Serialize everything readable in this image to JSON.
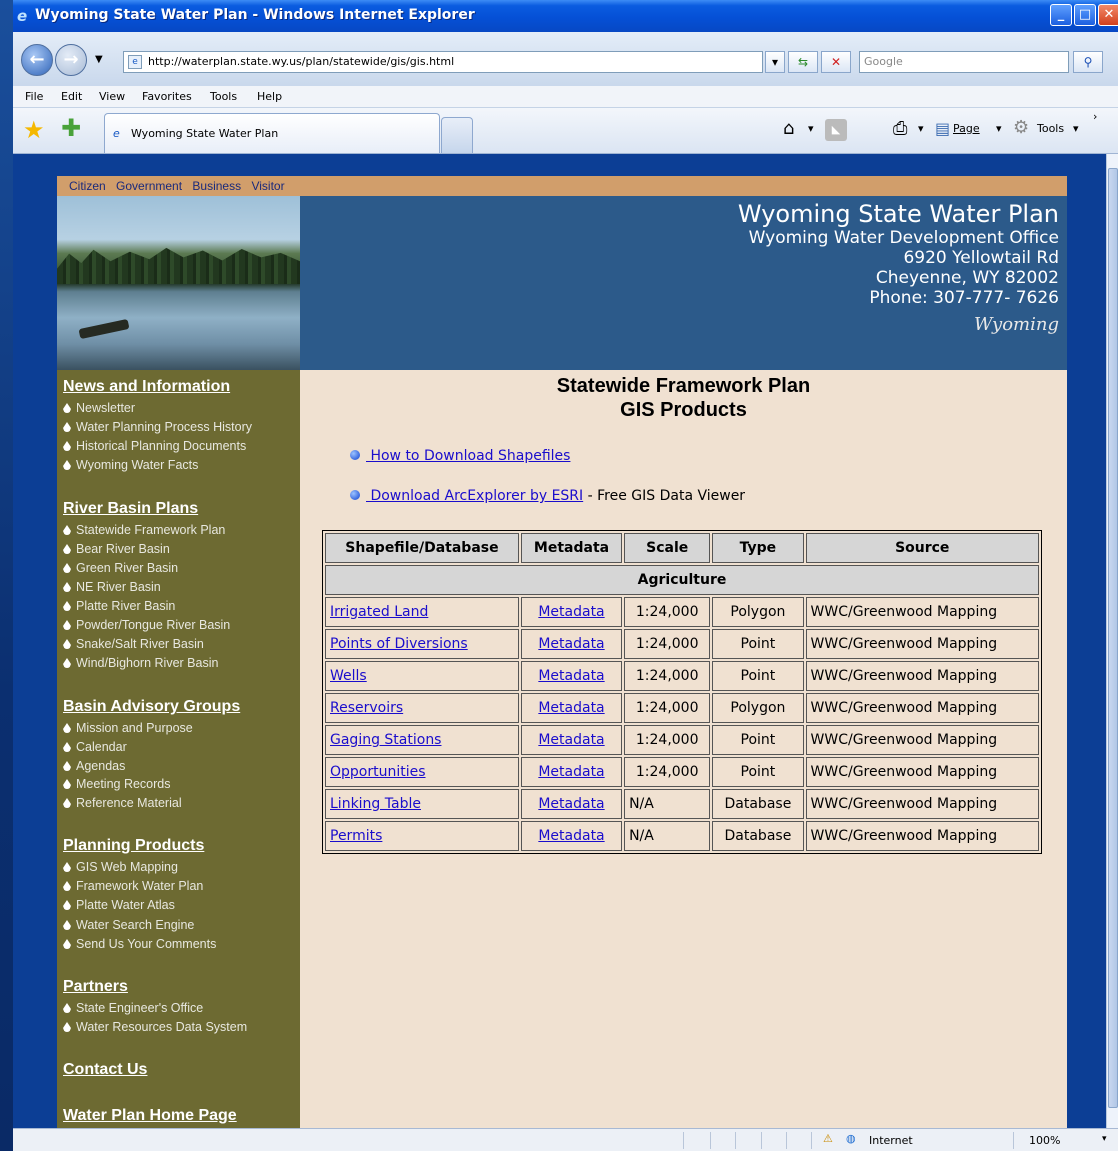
{
  "window": {
    "title": "Wyoming State Water Plan - Windows Internet Explorer"
  },
  "address": {
    "url": "http://waterplan.state.wy.us/plan/statewide/gis/gis.html"
  },
  "search": {
    "placeholder": "Google"
  },
  "menu": [
    "File",
    "Edit",
    "View",
    "Favorites",
    "Tools",
    "Help"
  ],
  "tab": {
    "label": "Wyoming State Water Plan"
  },
  "commands": {
    "page": "Page",
    "tools": "Tools"
  },
  "status": {
    "zone": "Internet",
    "zoom": "100%"
  },
  "topnav": [
    "Citizen",
    "Government",
    "Business",
    "Visitor"
  ],
  "header": {
    "title": "Wyoming State Water Plan",
    "office": "Wyoming Water Development Office",
    "street": "6920 Yellowtail Rd",
    "city": "Cheyenne, WY 82002",
    "phone": "Phone: 307-777- 7626",
    "logo": "Wyoming"
  },
  "sidebar": {
    "news": {
      "title": "News and Information",
      "items": [
        "Newsletter",
        "Water Planning Process History",
        "Historical Planning Documents",
        "Wyoming Water Facts"
      ]
    },
    "basins": {
      "title": "River Basin Plans",
      "items": [
        "Statewide Framework Plan",
        "Bear River Basin",
        "Green River Basin",
        "NE River Basin",
        "Platte River Basin",
        "Powder/Tongue River Basin",
        "Snake/Salt River Basin",
        "Wind/Bighorn River Basin"
      ]
    },
    "advisory": {
      "title": "Basin Advisory Groups",
      "items": [
        "Mission and Purpose",
        "Calendar",
        "Agendas",
        "Meeting Records",
        "Reference Material"
      ]
    },
    "products": {
      "title": "Planning Products",
      "items": [
        "GIS Web Mapping",
        "Framework Water Plan",
        "Platte Water Atlas",
        "Water Search Engine",
        "Send Us Your Comments"
      ]
    },
    "partners": {
      "title": "Partners",
      "items": [
        "State Engineer's Office",
        "Water Resources Data System"
      ]
    },
    "contact": "Contact Us",
    "home": "Water Plan Home Page"
  },
  "main": {
    "title1": "Statewide Framework Plan",
    "title2": "GIS Products",
    "link1": " How to Download Shapefiles",
    "link2": " Download ArcExplorer by ESRI",
    "link2_suffix": " - Free GIS Data Viewer",
    "table": {
      "headers": [
        "Shapefile/Database",
        "Metadata",
        "Scale",
        "Type",
        "Source"
      ],
      "section": "Agriculture",
      "rows": [
        [
          "Irrigated Land",
          "Metadata",
          "1:24,000",
          "Polygon",
          "WWC/Greenwood Mapping"
        ],
        [
          "Points of Diversions",
          "Metadata",
          "1:24,000",
          "Point",
          "WWC/Greenwood Mapping"
        ],
        [
          "Wells",
          "Metadata",
          "1:24,000",
          "Point",
          "WWC/Greenwood Mapping"
        ],
        [
          "Reservoirs",
          "Metadata",
          "1:24,000",
          "Polygon",
          "WWC/Greenwood Mapping"
        ],
        [
          "Gaging Stations",
          "Metadata",
          "1:24,000",
          "Point",
          "WWC/Greenwood Mapping"
        ],
        [
          "Opportunities",
          "Metadata",
          "1:24,000",
          "Point",
          "WWC/Greenwood Mapping"
        ],
        [
          "Linking Table",
          "Metadata",
          "N/A",
          "Database",
          "WWC/Greenwood Mapping"
        ],
        [
          "Permits",
          "Metadata",
          "N/A",
          "Database",
          "WWC/Greenwood Mapping"
        ]
      ]
    }
  }
}
